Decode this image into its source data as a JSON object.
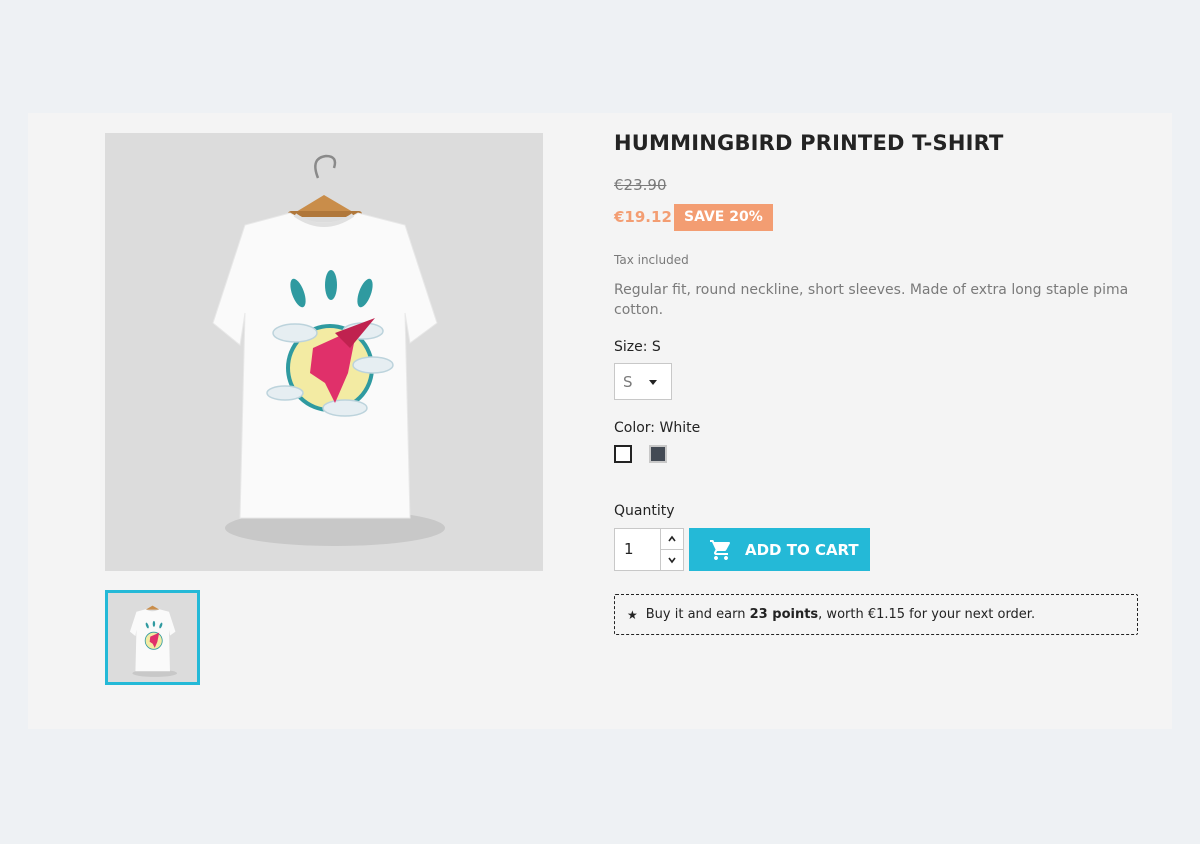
{
  "product": {
    "title": "HUMMINGBIRD PRINTED T-SHIRT",
    "old_price": "€23.90",
    "price": "€19.12",
    "discount": "SAVE 20%",
    "tax_note": "Tax included",
    "description": "Regular fit, round neckline, short sleeves. Made of extra long staple pima cotton."
  },
  "size": {
    "label": "Size: S",
    "selected": "S"
  },
  "color": {
    "label": "Color: White",
    "options": [
      {
        "name": "White",
        "hex": "#ffffff"
      },
      {
        "name": "Gray",
        "hex": "#434a54"
      }
    ]
  },
  "quantity": {
    "label": "Quantity",
    "value": "1"
  },
  "cart": {
    "add_label": "ADD TO CART"
  },
  "points": {
    "prefix": "Buy it and earn",
    "points_text": "23 points",
    "suffix": ", worth €1.15 for your next order."
  },
  "icons": {
    "cart": "shopping-cart-icon",
    "star": "star-icon",
    "up": "chevron-up-icon",
    "down": "chevron-down-icon"
  },
  "colors": {
    "accent": "#24b9d7",
    "discount": "#f39d72",
    "card_bg": "#f4f4f4",
    "page_bg": "#eef1f4"
  }
}
